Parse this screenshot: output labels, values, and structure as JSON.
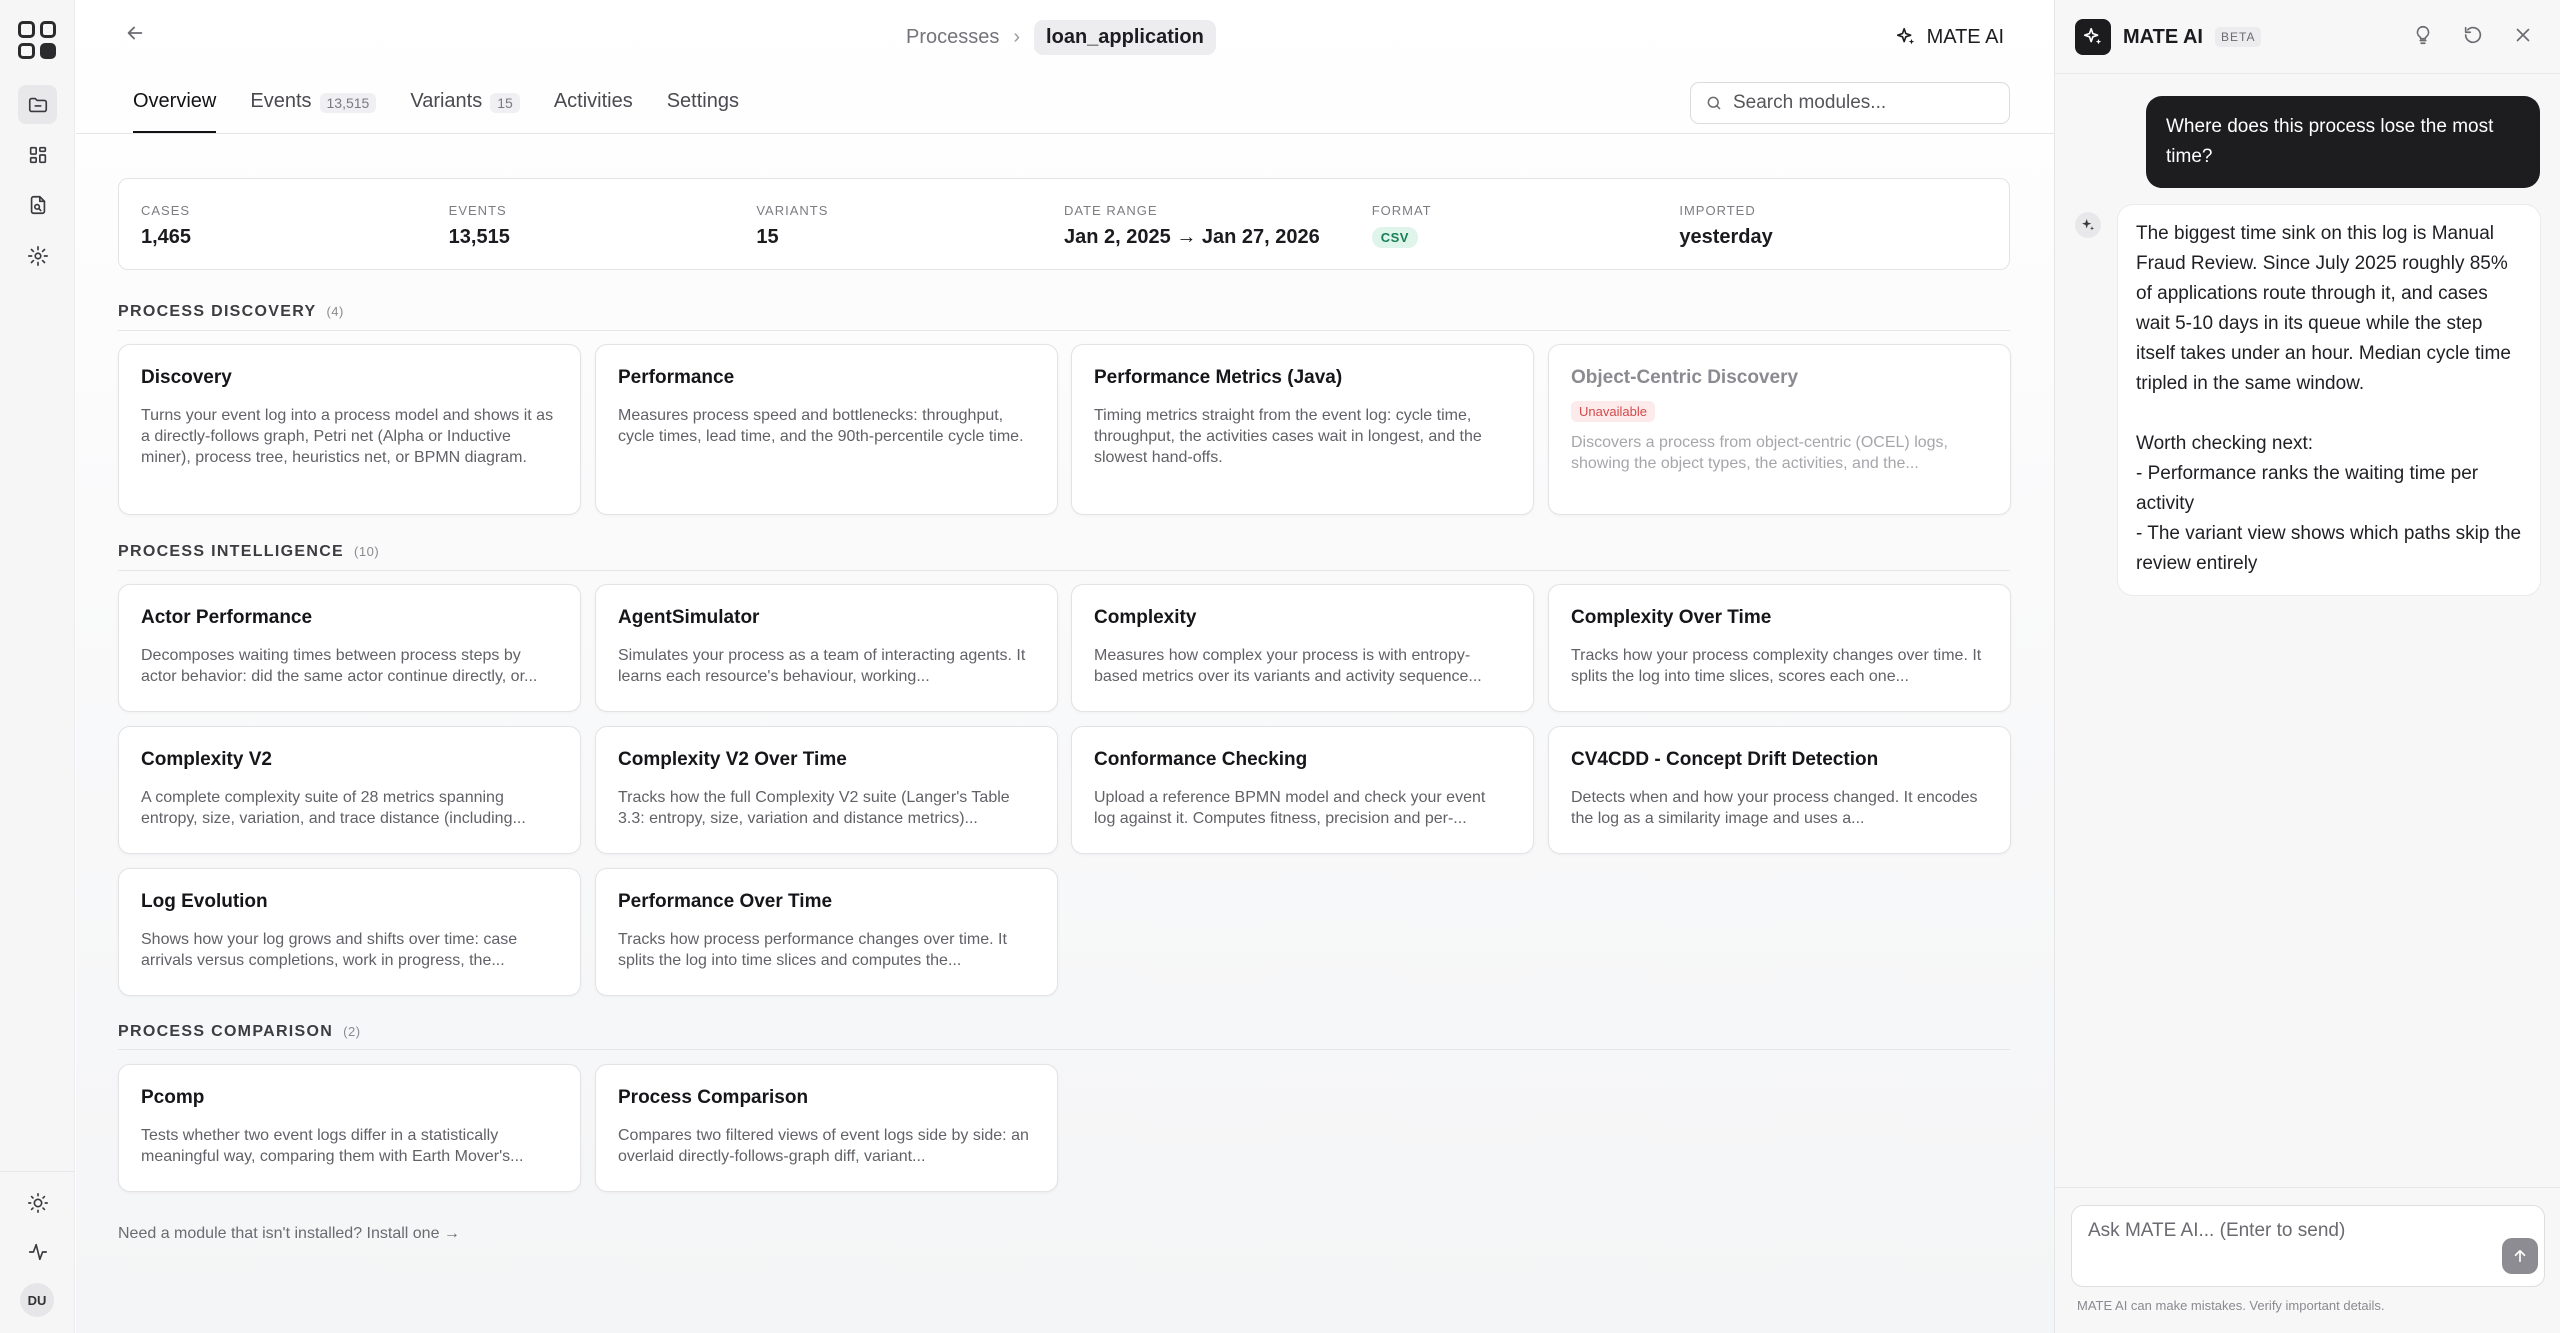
{
  "breadcrumb": {
    "parent": "Processes",
    "current": "loan_application"
  },
  "header": {
    "mate_button": "MATE AI"
  },
  "tabs": [
    {
      "label": "Overview",
      "count": ""
    },
    {
      "label": "Events",
      "count": "13,515"
    },
    {
      "label": "Variants",
      "count": "15"
    },
    {
      "label": "Activities",
      "count": ""
    },
    {
      "label": "Settings",
      "count": ""
    }
  ],
  "search": {
    "placeholder": "Search modules..."
  },
  "stats": {
    "cases_label": "CASES",
    "cases": "1,465",
    "events_label": "EVENTS",
    "events": "13,515",
    "variants_label": "VARIANTS",
    "variants": "15",
    "daterange_label": "DATE RANGE",
    "daterange": "Jan 2, 2025 → Jan 27, 2026",
    "format_label": "FORMAT",
    "format": "CSV",
    "imported_label": "IMPORTED",
    "imported": "yesterday"
  },
  "sections": {
    "discovery": {
      "title": "PROCESS DISCOVERY",
      "count": "(4)"
    },
    "intelligence": {
      "title": "PROCESS INTELLIGENCE",
      "count": "(10)"
    },
    "comparison": {
      "title": "PROCESS COMPARISON",
      "count": "(2)"
    }
  },
  "discovery_cards": [
    {
      "title": "Discovery",
      "desc": "Turns your event log into a process model and shows it as a directly-follows graph, Petri net (Alpha or Inductive miner), process tree, heuristics net, or BPMN diagram."
    },
    {
      "title": "Performance",
      "desc": "Measures process speed and bottlenecks: throughput, cycle times, lead time, and the 90th-percentile cycle time."
    },
    {
      "title": "Performance Metrics (Java)",
      "desc": "Timing metrics straight from the event log: cycle time, throughput, the activities cases wait in longest, and the slowest hand-offs."
    },
    {
      "title": "Object-Centric Discovery",
      "badge": "Unavailable",
      "desc": "Discovers a process from object-centric (OCEL) logs, showing the object types, the activities, and the..."
    }
  ],
  "intelligence_cards": [
    {
      "title": "Actor Performance",
      "desc": "Decomposes waiting times between process steps by actor behavior: did the same actor continue directly, or..."
    },
    {
      "title": "AgentSimulator",
      "desc": "Simulates your process as a team of interacting agents. It learns each resource's behaviour, working..."
    },
    {
      "title": "Complexity",
      "desc": "Measures how complex your process is with entropy-based metrics over its variants and activity sequence..."
    },
    {
      "title": "Complexity Over Time",
      "desc": "Tracks how your process complexity changes over time. It splits the log into time slices, scores each one..."
    },
    {
      "title": "Complexity V2",
      "desc": "A complete complexity suite of 28 metrics spanning entropy, size, variation, and trace distance (including..."
    },
    {
      "title": "Complexity V2 Over Time",
      "desc": "Tracks how the full Complexity V2 suite (Langer's Table 3.3: entropy, size, variation and distance metrics)..."
    },
    {
      "title": "Conformance Checking",
      "desc": "Upload a reference BPMN model and check your event log against it. Computes fitness, precision and per-..."
    },
    {
      "title": "CV4CDD - Concept Drift Detection",
      "desc": "Detects when and how your process changed. It encodes the log as a similarity image and uses a..."
    },
    {
      "title": "Log Evolution",
      "desc": "Shows how your log grows and shifts over time: case arrivals versus completions, work in progress, the..."
    },
    {
      "title": "Performance Over Time",
      "desc": "Tracks how process performance changes over time. It splits the log into time slices and computes the..."
    }
  ],
  "comparison_cards": [
    {
      "title": "Pcomp",
      "desc": "Tests whether two event logs differ in a statistically meaningful way, comparing them with Earth Mover's..."
    },
    {
      "title": "Process Comparison",
      "desc": "Compares two filtered views of event logs side by side: an overlaid directly-follows-graph diff, variant..."
    }
  ],
  "install_link": "Need a module that isn't installed? Install one →",
  "rail": {
    "avatar": "DU"
  },
  "panel": {
    "title": "MATE AI",
    "beta": "BETA",
    "user_message": "Where does this process lose the most time?",
    "ai_para1": "The biggest time sink on this log is Manual Fraud Review. Since July 2025 roughly 85% of applications route through it, and cases wait 5-10 days in its queue while the step itself takes under an hour. Median cycle time tripled in the same window.",
    "ai_para2": "Worth checking next:",
    "ai_bullet1": "- Performance ranks the waiting time per activity",
    "ai_bullet2": "- The variant view shows which paths skip the review entirely",
    "input_placeholder": "Ask MATE AI... (Enter to send)",
    "disclaimer": "MATE AI can make mistakes. Verify important details."
  },
  "icons": {
    "rail": [
      "app-grid-icon",
      "folder-icon",
      "dashboard-icon",
      "file-search-icon",
      "settings-gear-icon",
      "sun-icon",
      "activity-icon"
    ],
    "panel": [
      "lightbulb-icon",
      "refresh-icon",
      "close-icon",
      "send-arrow-icon"
    ]
  }
}
